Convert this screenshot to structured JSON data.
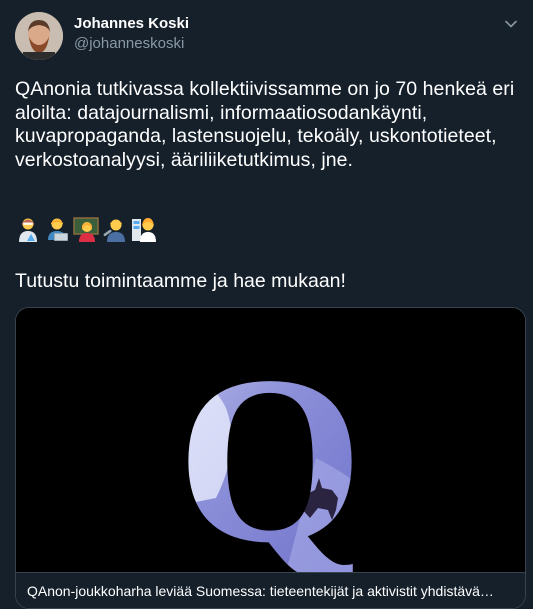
{
  "author": {
    "name": "Johannes Koski",
    "handle": "@johanneskoski"
  },
  "tweet": {
    "text": "QAnonia tutkivassa kollektiivissamme on jo 70 henkeä eri aloilta: datajournalismi, informaatiosodankäynti, kuvapropaganda, lastensuojelu, tekoäly, uskontotieteet, verkostoanalyysi, ääriliiketutkimus, jne.",
    "emojis": [
      "scientist-icon",
      "technologist-icon",
      "teacher-icon",
      "mechanic-icon",
      "office-worker-icon"
    ],
    "cta": "Tutustu toimintaamme ja hae mukaan!"
  },
  "card": {
    "image_letter": "Q",
    "title": "QAnon-joukkoharha leviää Suomessa: tieteentekijät ja aktivistit yhdistävä…"
  },
  "colors": {
    "background": "#15202b",
    "secondary_text": "#8899a6",
    "border": "#38444d"
  }
}
